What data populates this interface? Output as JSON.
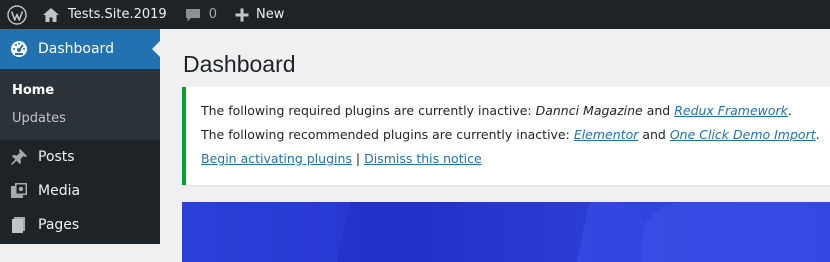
{
  "adminbar": {
    "site_name": "Tests.Site.2019",
    "comments_count": "0",
    "new_label": "New",
    "icons": {
      "wp": "wordpress-logo-icon",
      "home": "home-icon",
      "comments": "comment-bubble-icon",
      "new": "plus-icon"
    }
  },
  "sidebar": {
    "active": {
      "label": "Dashboard",
      "icon": "dashboard-gauge-icon"
    },
    "submenu": [
      {
        "label": "Home",
        "current": true
      },
      {
        "label": "Updates",
        "current": false
      }
    ],
    "items": [
      {
        "label": "Posts",
        "icon": "pushpin-icon"
      },
      {
        "label": "Media",
        "icon": "media-icon"
      },
      {
        "label": "Pages",
        "icon": "pages-icon"
      }
    ]
  },
  "main": {
    "title": "Dashboard",
    "notice": {
      "line1_prefix": "The following required plugins are currently inactive: ",
      "line1_plugin1": "Dannci Magazine",
      "line1_and": " and ",
      "line1_plugin2": "Redux Framework",
      "line1_suffix": ".",
      "line2_prefix": "The following recommended plugins are currently inactive: ",
      "line2_plugin1": "Elementor",
      "line2_and": " and ",
      "line2_plugin2": "One Click Demo Import",
      "line2_suffix": ".",
      "action_activate": "Begin activating plugins",
      "action_sep": " | ",
      "action_dismiss": "Dismiss this notice"
    }
  },
  "colors": {
    "adminbar_bg": "#1d2327",
    "accent": "#2271b1",
    "notice_success": "#00a32a",
    "banner": "#2b40d8"
  }
}
